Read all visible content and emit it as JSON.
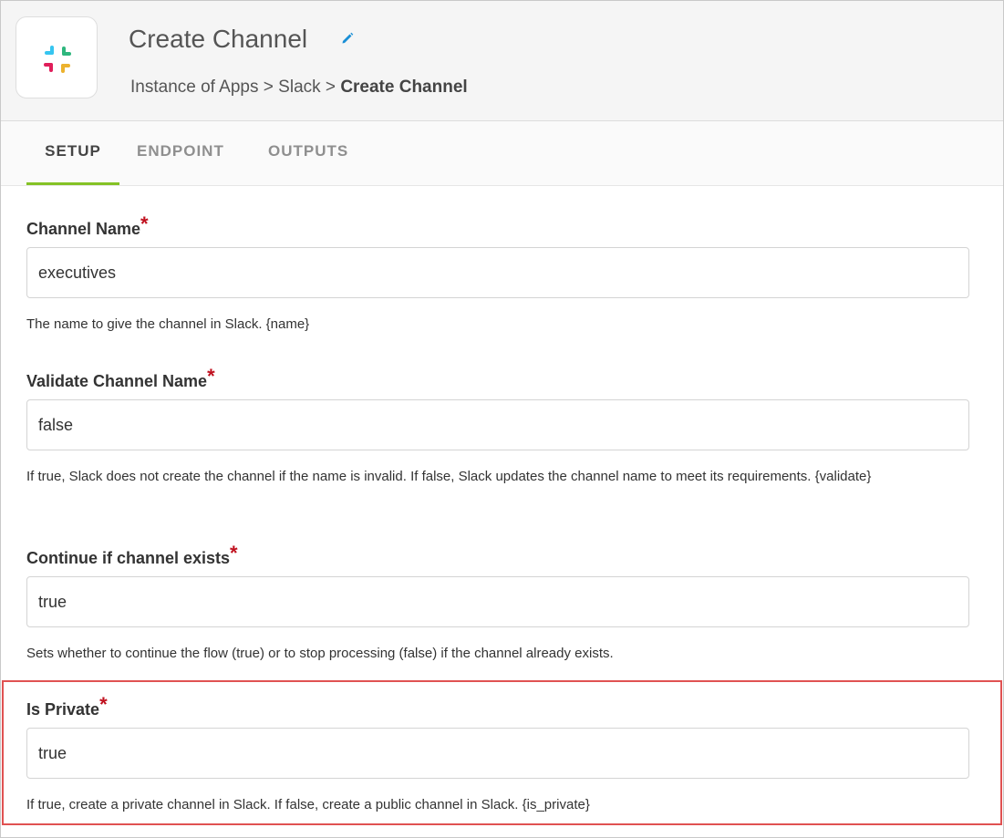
{
  "header": {
    "title": "Create Channel",
    "breadcrumb": {
      "part1": "Instance of Apps",
      "sep1": ">",
      "part2": "Slack",
      "sep2": ">",
      "current": "Create Channel"
    }
  },
  "tabs": [
    {
      "label": "SETUP",
      "active": true
    },
    {
      "label": "ENDPOINT",
      "active": false
    },
    {
      "label": "OUTPUTS",
      "active": false
    }
  ],
  "fields": [
    {
      "label": "Channel Name",
      "required_mark": "*",
      "value": "executives",
      "help": "The name to give the channel in Slack. {name}"
    },
    {
      "label": "Validate Channel Name",
      "required_mark": "*",
      "value": "false",
      "help": "If true, Slack does not create the channel if the name is invalid. If false, Slack updates the channel name to meet its requirements. {validate}"
    },
    {
      "label": "Continue if channel exists",
      "required_mark": "*",
      "value": "true",
      "help": "Sets whether to continue the flow (true) or to stop processing (false) if the channel already exists."
    },
    {
      "label": "Is Private",
      "required_mark": "*",
      "value": "true",
      "help": "If true, create a private channel in Slack. If false, create a public channel in Slack. {is_private}"
    }
  ],
  "icons": {
    "app": "slack-logo-icon",
    "edit": "pencil-icon"
  },
  "colors": {
    "active_tab_underline": "#84c225",
    "required_mark": "#c0111f",
    "highlight_border": "#e05252",
    "edit_icon": "#1a8fd6"
  }
}
